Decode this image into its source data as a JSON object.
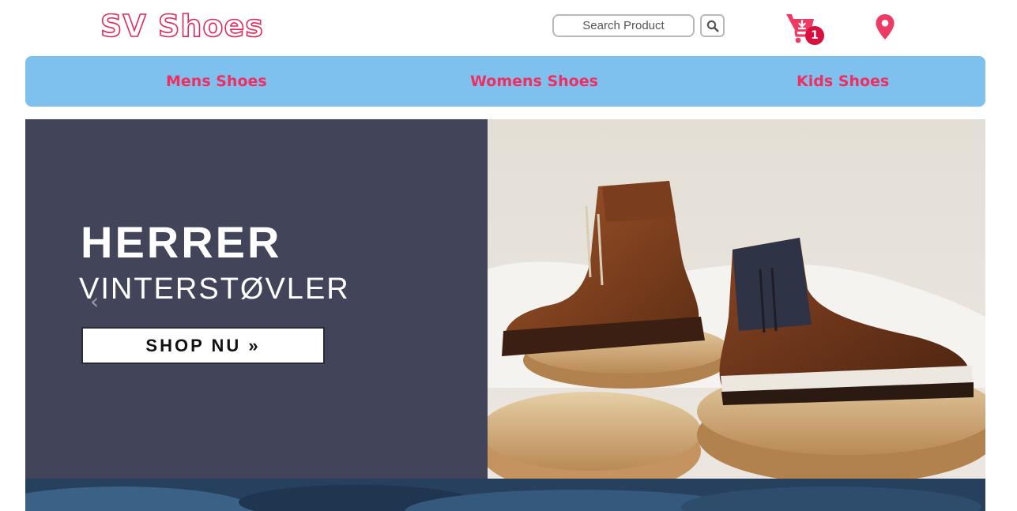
{
  "brand": {
    "logo_text": "SV Shoes",
    "accent_color": "#e3285a"
  },
  "header": {
    "search": {
      "placeholder": "Search Product",
      "value": ""
    },
    "search_icon": "search-icon",
    "cart": {
      "icon": "cart-download-icon",
      "count": "1"
    },
    "location_icon": "map-pin-icon"
  },
  "nav": {
    "background": "#7fc1ee",
    "link_color": "#ef2e61",
    "items": [
      {
        "label": "Mens Shoes"
      },
      {
        "label": "Womens Shoes"
      },
      {
        "label": "Kids Shoes"
      }
    ]
  },
  "banner": {
    "headline": "HERRER",
    "subline": "VINTERSTØVLER",
    "cta": "SHOP NU »",
    "prev_icon": "chevron-left-icon",
    "panel_color": "#42445a"
  }
}
